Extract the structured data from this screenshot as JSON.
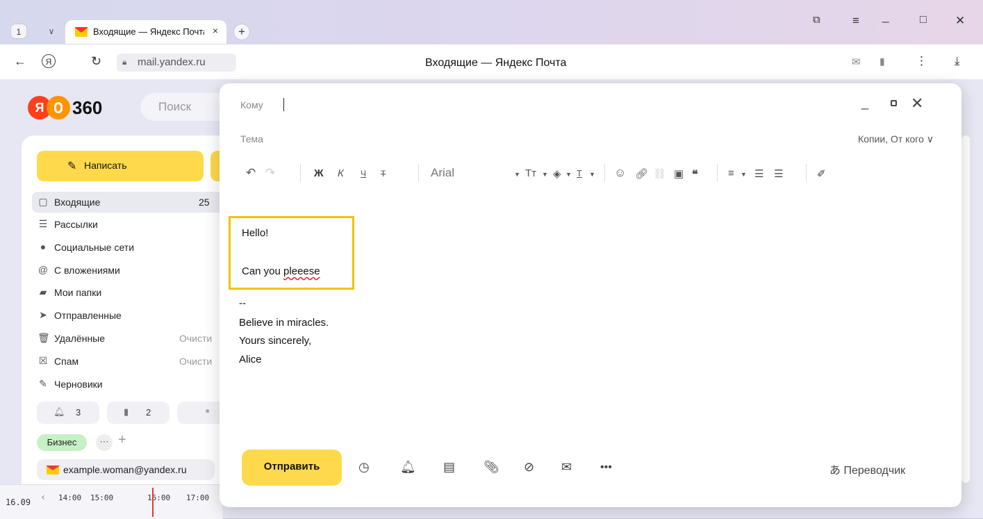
{
  "browser": {
    "tab_count": "1",
    "tab_title": "Входящие — Яндекс Почта",
    "url": "mail.yandex.ru",
    "page_title": "Входящие — Яндекс Почта",
    "glyphs": {
      "back": "←",
      "yandex": "Я",
      "reload": "↻",
      "menu": "⋮",
      "download": "⤓",
      "new_tab": "+",
      "close": "×",
      "minimize": "_",
      "maximize": "□",
      "win_close": "✕",
      "hamburger": "≡",
      "chev": "∨"
    }
  },
  "mail": {
    "logo_ya": "Я",
    "logo_text": "360",
    "search_placeholder": "Поиск",
    "compose_label": "Написать",
    "folders": [
      {
        "label": "Входящие",
        "count": "25",
        "icon": "inbox-icon"
      },
      {
        "label": "Рассылки",
        "icon": "newsletter-icon"
      },
      {
        "label": "Социальные сети",
        "icon": "social-icon"
      },
      {
        "label": "С вложениями",
        "icon": "attachment-icon"
      },
      {
        "label": "Мои папки",
        "icon": "folder-icon"
      },
      {
        "label": "Отправленные",
        "icon": "sent-icon"
      },
      {
        "label": "Удалённые",
        "action": "Очисти",
        "icon": "trash-icon"
      },
      {
        "label": "Спам",
        "action": "Очисти",
        "icon": "spam-icon"
      },
      {
        "label": "Черновики",
        "icon": "drafts-icon"
      }
    ],
    "chips": {
      "reminders": "3",
      "bookmarks": "2"
    },
    "label_business": "Бизнес",
    "account": "example.woman@yandex.ru",
    "timeline": {
      "date": "16.09",
      "times": [
        "14:00",
        "15:00",
        "16:00",
        "17:00"
      ]
    }
  },
  "composer": {
    "to_label": "Кому",
    "subject_label": "Тема",
    "cc_label": "Копии, От кого",
    "font_name": "Arial",
    "toolbar": {
      "bold": "Ж",
      "italic": "К",
      "underline": "Ч",
      "strike": "Т"
    },
    "body_lines": [
      "Hello!",
      "Can you ",
      "pleeese"
    ],
    "signature": [
      "--",
      "Believe in miracles.",
      "Yours sincerely,",
      "Alice"
    ],
    "send_label": "Отправить",
    "translator_label": "Переводчик"
  },
  "colors": {
    "accent_yellow": "#fed94c",
    "highlight_box": "#f2c200",
    "logo_red": "#fc3f1d",
    "logo_orange": "#ff9300",
    "label_green": "#c6f0c5"
  }
}
